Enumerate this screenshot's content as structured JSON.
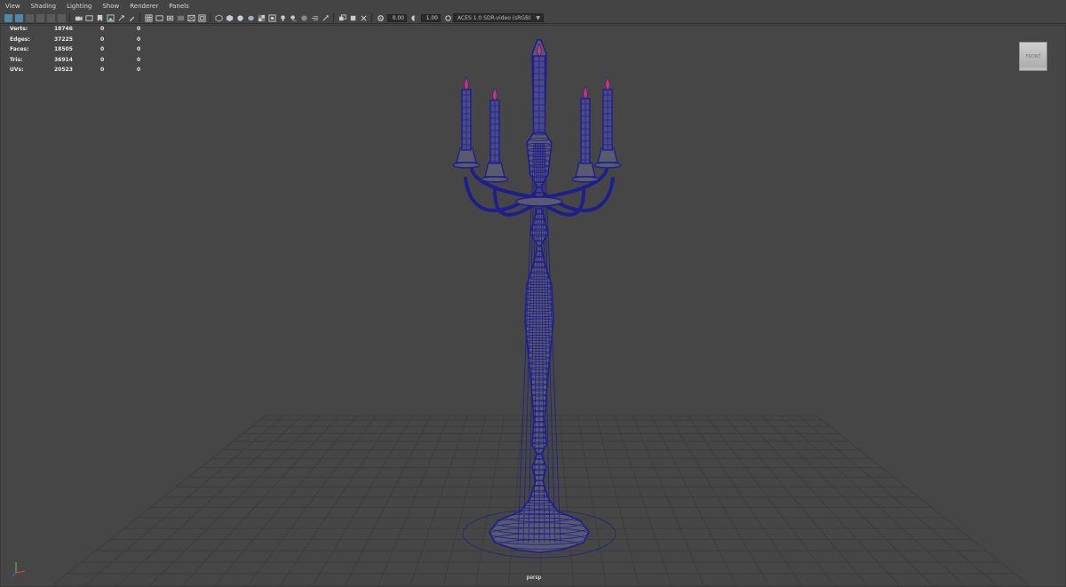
{
  "menubar": {
    "items": [
      "View",
      "Shading",
      "Lighting",
      "Show",
      "Renderer",
      "Panels"
    ]
  },
  "toolbar": {
    "exposure_value": "0.00",
    "gamma_value": "1.00",
    "color_space": "ACES 1.0 SDR-video (sRGB)"
  },
  "hud": {
    "rows": [
      {
        "label": "Verts:",
        "v1": "18746",
        "v2": "0",
        "v3": "0"
      },
      {
        "label": "Edges:",
        "v1": "37225",
        "v2": "0",
        "v3": "0"
      },
      {
        "label": "Faces:",
        "v1": "18505",
        "v2": "0",
        "v3": "0"
      },
      {
        "label": "Tris:",
        "v1": "36914",
        "v2": "0",
        "v3": "0"
      },
      {
        "label": "UVs:",
        "v1": "20523",
        "v2": "0",
        "v3": "0"
      }
    ]
  },
  "viewcube": {
    "face_label": "FRONT"
  },
  "viewport": {
    "camera_label": "persp"
  },
  "colors": {
    "viewport_bg": "#464646",
    "wire": "#1e1e8c",
    "mesh_fill": "#5a5a6e",
    "grid": "#3d3d3d",
    "accent": "#5285a6",
    "flame": "#d2326e"
  },
  "icons": [
    "select-camera-icon",
    "camera-attributes-icon",
    "bookmark-icon",
    "image-plane-icon",
    "grid-icon",
    "film-gate-icon",
    "resolution-gate-icon",
    "safe-action-icon",
    "wireframe-icon",
    "smooth-shade-icon",
    "textured-icon",
    "lights-icon",
    "shadows-icon",
    "xray-icon",
    "isolate-select-icon",
    "exposure-icon",
    "gamma-icon",
    "color-management-icon"
  ]
}
